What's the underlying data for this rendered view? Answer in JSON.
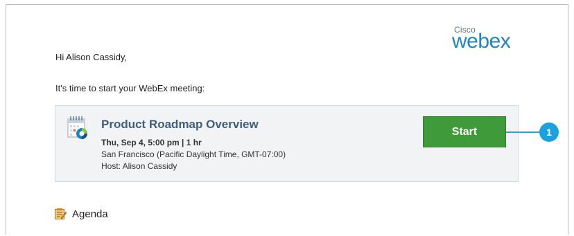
{
  "logo": {
    "cisco": "Cisco",
    "webex": "webex"
  },
  "email": {
    "greeting": "Hi Alison Cassidy,",
    "intro": "It's time to start your WebEx meeting:"
  },
  "meeting": {
    "title": "Product Roadmap Overview",
    "time": "Thu, Sep 4, 5:00 pm | 1 hr",
    "location": "San Francisco (Pacific Daylight Time, GMT-07:00)",
    "host": "Host: Alison Cassidy",
    "start_label": "Start"
  },
  "callout": {
    "number": "1"
  },
  "agenda": {
    "label": "Agenda",
    "icon": "agenda-notepad-icon"
  },
  "colors": {
    "start_button": "#3f9a3a",
    "callout": "#1da1dd",
    "title": "#3f5e7a",
    "webex_blue": "#1f84c4"
  }
}
